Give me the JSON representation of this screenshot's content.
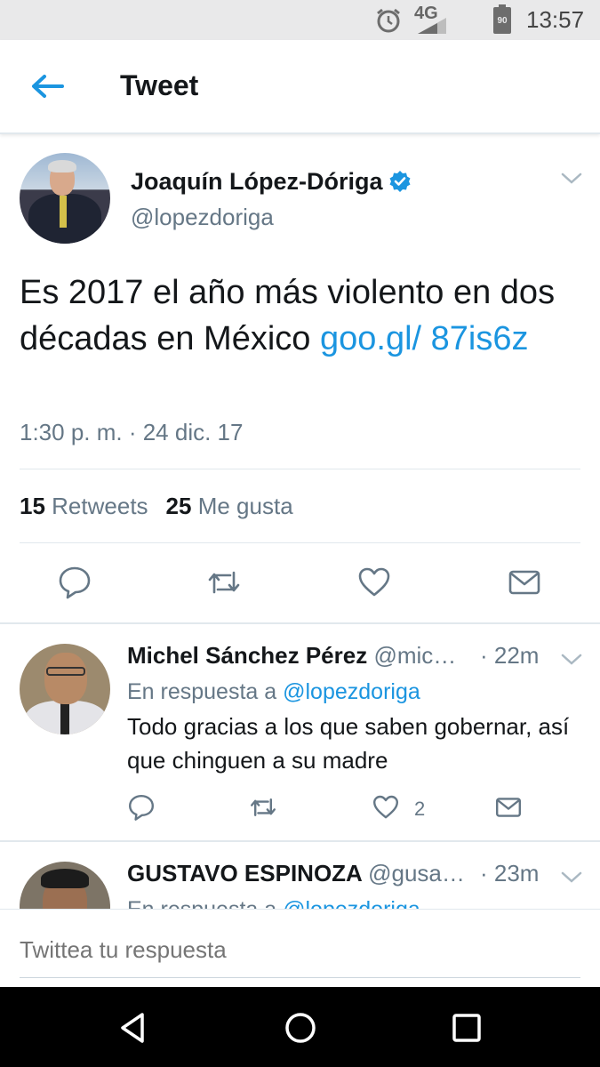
{
  "status_bar": {
    "network": "4G",
    "battery": "90",
    "time": "13:57"
  },
  "app_bar": {
    "title": "Tweet"
  },
  "main_tweet": {
    "author_name": "Joaquín López-Dóriga",
    "author_handle": "@lopezdoriga",
    "text": "Es 2017 el año más violento en dos décadas en México ",
    "link": "goo.gl/ 87is6z",
    "timestamp": "1:30 p. m. · 24 dic. 17",
    "retweets_count": "15",
    "retweets_label": "Retweets",
    "likes_count": "25",
    "likes_label": "Me gusta"
  },
  "replies": [
    {
      "name": "Michel Sánchez Pérez",
      "handle": "@mic…",
      "time": "· 22m",
      "reply_prefix": "En respuesta a",
      "reply_mention": "@lopezdoriga",
      "text": "Todo gracias a los que saben gobernar, así que chinguen a su madre",
      "likes": "2"
    },
    {
      "name": "GUSTAVO ESPINOZA",
      "handle": "@gusa…",
      "time": "· 23m",
      "reply_prefix": "En respuesta a",
      "reply_mention": "@lopezdoriga"
    }
  ],
  "compose": {
    "placeholder": "Twittea tu respuesta"
  },
  "icons": {
    "accent": "#1b95e0",
    "verified": "verified-badge-icon",
    "back": "back-arrow-icon",
    "reply": "reply-icon",
    "retweet": "retweet-icon",
    "like": "heart-icon",
    "dm": "mail-icon"
  }
}
